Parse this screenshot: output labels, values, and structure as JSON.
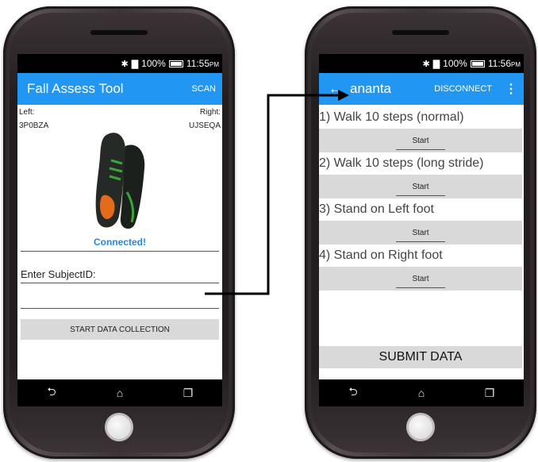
{
  "status": {
    "battery": "100%",
    "time_left": "11:55",
    "time_right": "11:56",
    "ampm": "PM"
  },
  "left_app": {
    "title": "Fall Assess Tool",
    "action": "SCAN",
    "left_label": "Left:",
    "right_label": "Right:",
    "left_id": "3P0BZA",
    "right_id": "UJSEQA",
    "connected": "Connected!",
    "subject_label": "Enter SubjectID:",
    "start_button": "START DATA COLLECTION"
  },
  "right_app": {
    "back_glyph": "←",
    "title": "ananta",
    "action": "DISCONNECT",
    "more_glyph": "⋮",
    "tasks": [
      {
        "label": "1) Walk 10 steps (normal)",
        "button": "Start"
      },
      {
        "label": "2) Walk 10 steps (long stride)",
        "button": "Start"
      },
      {
        "label": "3) Stand on Left foot",
        "button": "Start"
      },
      {
        "label": "4) Stand on Right foot",
        "button": "Start"
      }
    ],
    "submit": "SUBMIT DATA"
  },
  "nav": {
    "back": "⮌",
    "home": "⌂",
    "recent": "❐"
  },
  "colors": {
    "appbar": "#2196f3",
    "connected": "#1e88e5",
    "button": "#d9d9d9"
  },
  "icons": [
    "bluetooth-icon",
    "signal-icon",
    "battery-icon",
    "back-arrow-icon",
    "overflow-menu-icon",
    "nav-back-icon",
    "nav-home-icon",
    "nav-recent-icon"
  ]
}
